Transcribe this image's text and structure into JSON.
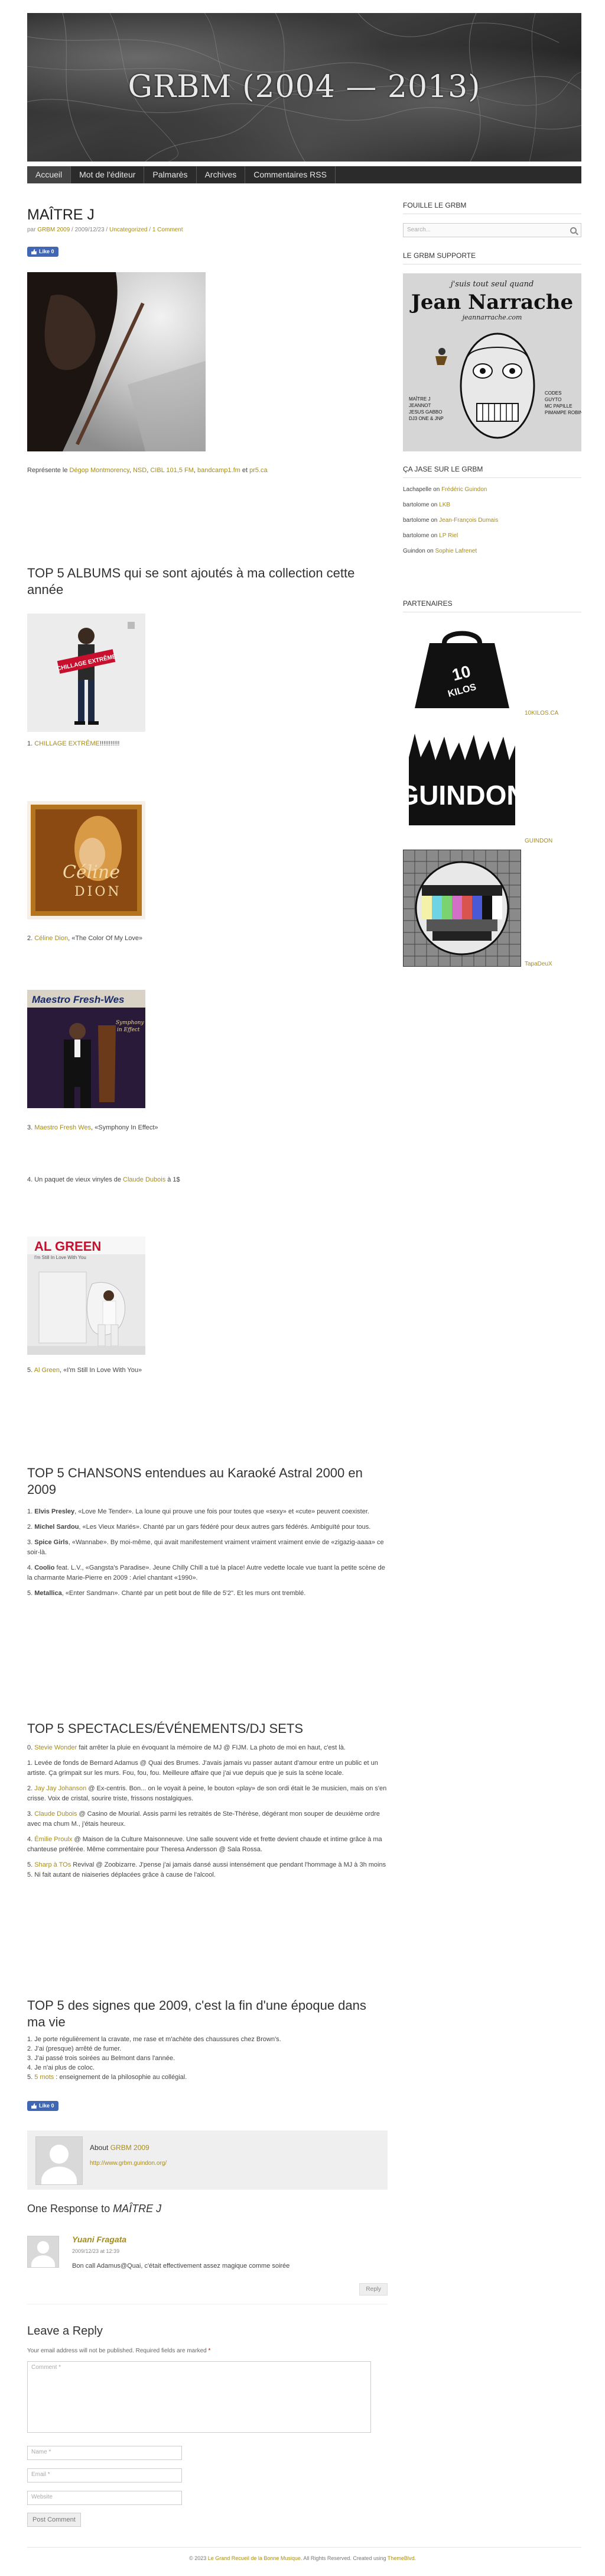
{
  "site": {
    "title": "GRBM (2004 — 2013)",
    "nav": [
      "Accueil",
      "Mot de l'éditeur",
      "Palmarès",
      "Archives",
      "Commentaires RSS"
    ]
  },
  "post": {
    "title": "MAÎTRE J",
    "meta": {
      "by": "par",
      "author": "GRBM 2009",
      "date": " / 2009/12/23 / ",
      "category": "Uncategorized",
      "sep": " / ",
      "comments": "1 Comment"
    },
    "like_label": "Like 0",
    "represents": {
      "prefix": "Représente le ",
      "links": [
        "Dégop Montmorency",
        "NSD",
        "CIBL 101,5 FM",
        "bandcamp1.fm",
        "pr5.ca"
      ],
      "seps": [
        ", ",
        ", ",
        ", ",
        " et "
      ],
      "suffix": ""
    },
    "albums": {
      "heading": "TOP 5 ALBUMS qui se sont ajoutés à ma collection cette année",
      "items": [
        {
          "num": "1. ",
          "artist": "CHILLAGE EXTRÊME",
          "title": "!!!!!!!!!!!"
        },
        {
          "num": "2. ",
          "artist": "Céline Dion",
          "title": ", «The Color Of My Love»"
        },
        {
          "num": "3. ",
          "artist": "Maestro Fresh Wes",
          "title": ", «Symphony In Effect»"
        },
        {
          "num": "4. Un paquet de vieux vinyles de ",
          "artist": "Claude Dubois",
          "title": " à 1$"
        },
        {
          "num": "5. ",
          "artist": "Al Green",
          "title": ", «I'm Still In Love With You»"
        }
      ]
    },
    "songs": {
      "heading": "TOP 5 CHANSONS entendues au Karaoké Astral 2000 en 2009",
      "items": [
        {
          "num": "1. ",
          "artist": "Elvis Presley",
          "text": ", «Love Me Tender». La loune qui prouve une fois pour toutes que «sexy» et «cute» peuvent coexister."
        },
        {
          "num": "2. ",
          "artist": "Michel Sardou",
          "text": ", «Les Vieux Mariés». Chanté par un gars fédéré pour deux autres gars fédérés. Ambiguïté pour tous."
        },
        {
          "num": "3. ",
          "artist": "Spice Girls",
          "text": ", «Wannabe». By moi-même, qui avait manifestement vraiment vraiment vraiment envie de «zigazig-aaaa» ce soir-là."
        },
        {
          "num": "4. ",
          "artist": "Coolio",
          "text": " feat. L.V., «Gangsta's Paradise». Jeune Chilly Chill a tué la place! Autre vedette locale vue tuant la petite scène de la charmante Marie-Pierre en 2009 : Ariel chantant «1990»."
        },
        {
          "num": "5. ",
          "artist": "Metallica",
          "text": ", «Enter Sandman». Chanté par un petit bout de fille de 5'2\". Et les murs ont tremblé."
        }
      ]
    },
    "shows": {
      "heading": "TOP 5 SPECTACLES/ÉVÉNEMENTS/DJ SETS",
      "items": [
        {
          "num": "0. ",
          "artist": "Stevie Wonder",
          "text": " fait arrêter la pluie en évoquant la mémoire de MJ @ FIJM. La photo de moi en haut, c'est là."
        },
        {
          "num": "1. ",
          "artist": "",
          "text": "Levée de fonds de Bernard Adamus @ Quai des Brumes. J'avais jamais vu passer autant d'amour entre un public et un artiste. Ça grimpait sur les murs. Fou, fou, fou. Meilleure affaire que j'ai vue depuis que je suis la scène locale."
        },
        {
          "num": "2. ",
          "artist": "Jay Jay Johanson",
          "text": " @ Ex-centris. Bon... on le voyait à peine, le bouton «play» de son ordi était le 3e musicien, mais on s'en crisse. Voix de cristal, sourire triste, frissons nostalgiques."
        },
        {
          "num": "3. ",
          "artist": "Claude Dubois",
          "text": " @ Casino de Mourial. Assis parmi les retraités de Ste-Thérèse, dégérant mon souper de deuxième ordre avec ma chum M., j'étais heureux."
        },
        {
          "num": "4. ",
          "artist": "Émilie Proulx",
          "text": " @ Maison de la Culture Maisonneuve. Une salle souvent vide et frette devient chaude et intime grâce à ma chanteuse préférée. Même commentaire pour Theresa Andersson @ Sala Rossa."
        },
        {
          "num": "5. ",
          "artist": "Sharp à TOs",
          "text": " Revival @ Zoobizarre. J'pense j'ai jamais dansé aussi intensément que pendant l'hommage à MJ à 3h moins 5. Ni fait autant de niaiseries déplacées grâce à cause de l'alcool."
        }
      ]
    },
    "signs": {
      "heading": "TOP 5 des signes que 2009, c'est la fin d'une époque dans ma vie",
      "items": [
        "1. Je porte régulièrement la cravate, me rase et m'achète des chaussures chez Brown's.",
        "2. J'ai (presque) arrêté de fumer.",
        "3. J'ai passé trois soirées au Belmont dans l'année.",
        "4. Je n'ai plus de coloc.",
        {
          "pre": "5. ",
          "link": "5 mots",
          "post": " : enseignement de la philosophie au collégial."
        }
      ]
    },
    "like_label_2": "Like 0"
  },
  "author_box": {
    "about": "About",
    "name": "GRBM 2009",
    "url": "http://www.grbm.guindon.org/"
  },
  "comments": {
    "heading_prefix": "One Response to ",
    "heading_title": "MAÎTRE J",
    "items": [
      {
        "author": "Yuani Fragata",
        "date": "2009/12/23 at 12:39",
        "text": "Bon call Adamus@Quai, c'était effectivement assez magique comme soirée",
        "reply": "Reply"
      }
    ]
  },
  "reply_form": {
    "heading": "Leave a Reply",
    "note": "Your email address will not be published. Required fields are marked ",
    "required_mark": "*",
    "comment_placeholder": "Comment *",
    "name_placeholder": "Name *",
    "email_placeholder": "Email *",
    "website_placeholder": "Website",
    "submit": "Post Comment"
  },
  "sidebar": {
    "search_heading": "FOUILLE LE GRBM",
    "search_placeholder": "Search...",
    "support_heading": "LE GRBM SUPPORTE",
    "poster": {
      "top_line": "Jean Narrache",
      "sub_line": "j'suis tout seul quand",
      "url": "jeannarrache.com",
      "left_text": "MAÎTRE J\nJEANNOT\nJESUS GABBO\nDJ3 ONE & JNP",
      "right_text": "CODES\nGUYTO\nMC PAPILLE\nPIMAMPE ROBIN"
    },
    "recent_heading": "ÇA JASE SUR LE GRBM",
    "recent": [
      {
        "who": "Lachapelle",
        "on": " on ",
        "post": "Frédéric Guindon"
      },
      {
        "who": "bartolome",
        "on": " on ",
        "post": "LKB"
      },
      {
        "who": "bartolome",
        "on": " on ",
        "post": "Jean-François Dumais"
      },
      {
        "who": "bartolome",
        "on": " on ",
        "post": "LP Riel"
      },
      {
        "who": "Guindon",
        "on": " on ",
        "post": "Sophie Lafrenet"
      }
    ],
    "partners_heading": "PARTENAIRES",
    "partners": [
      {
        "label": "10KILOS.CA",
        "logo_text": "10 KILOS"
      },
      {
        "label": "GUINDON",
        "logo_text": "GUINDON"
      },
      {
        "label": "TapaDeuX",
        "logo_text": ""
      }
    ]
  },
  "footer": {
    "pre": "© 2023 ",
    "link1": "Le Grand Recueil de la Bonne Musique",
    "mid": ". All Rights Reserved. Created using ",
    "link2": "ThemeBlvd",
    "post": "."
  },
  "colors": {
    "accent": "#a68c18",
    "nav_bg": "#2b2b2b",
    "like": "#4267b2"
  }
}
